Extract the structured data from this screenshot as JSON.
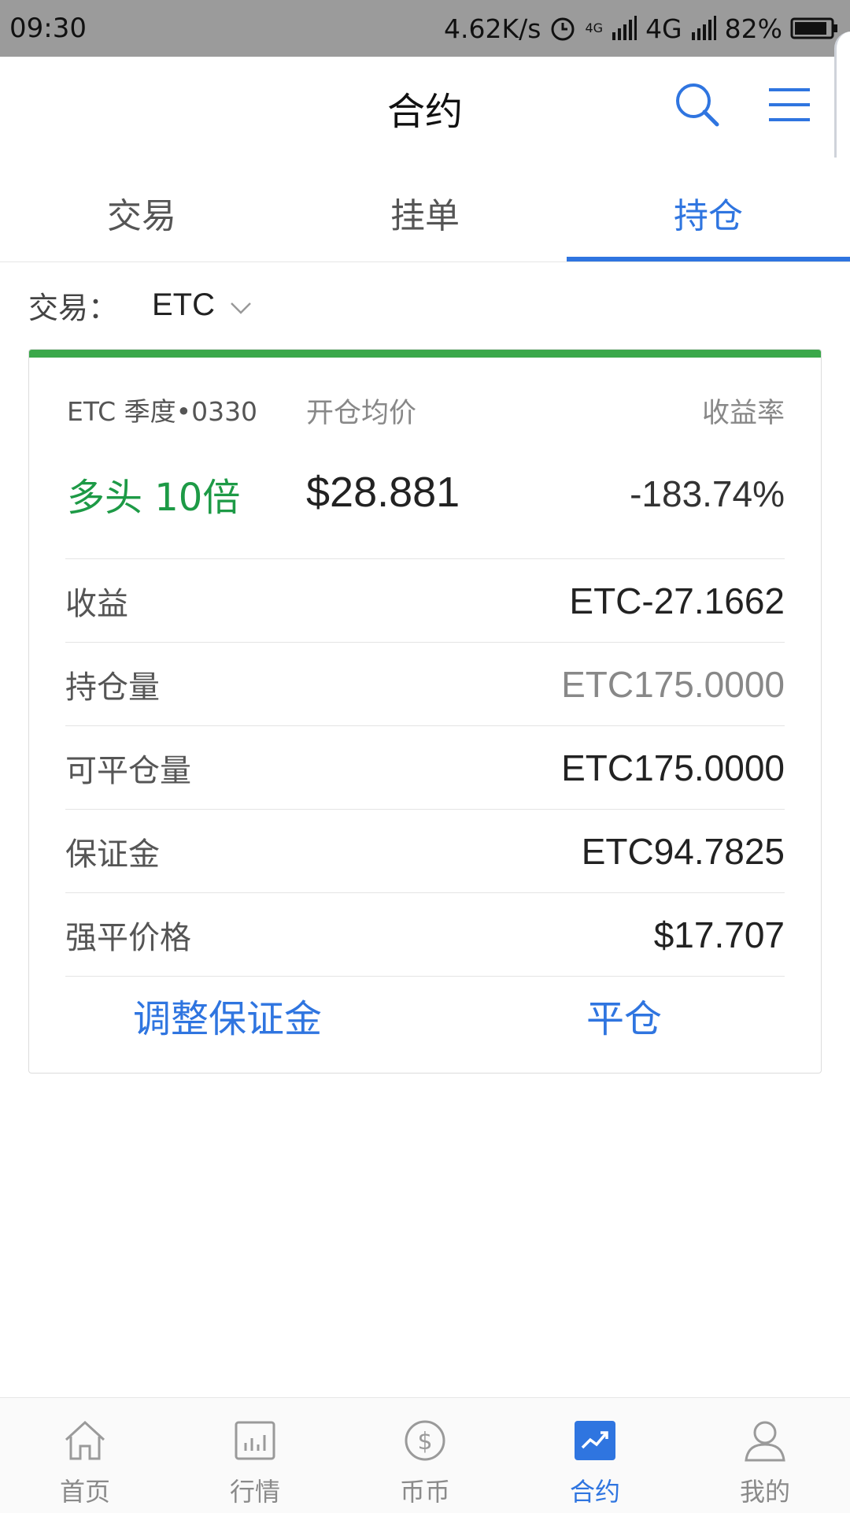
{
  "status_bar": {
    "time": "09:30",
    "net_speed": "4.62K/s",
    "network_type": "4G",
    "small_network": "4G",
    "battery": "82%",
    "icons": [
      "alarm-icon",
      "signal-icon",
      "battery-icon"
    ]
  },
  "header": {
    "title": "合约",
    "icons": [
      "search-icon",
      "menu-icon"
    ]
  },
  "tabs": [
    {
      "label": "交易",
      "active": false
    },
    {
      "label": "挂单",
      "active": false
    },
    {
      "label": "持仓",
      "active": true
    }
  ],
  "filter": {
    "label": "交易：",
    "value": "ETC"
  },
  "position": {
    "name": "ETC 季度•0330",
    "avg_price_label": "开仓均价",
    "rate_label": "收益率",
    "direction": "多头 10倍",
    "avg_price": "$28.881",
    "rate": "-183.74%",
    "rows": [
      {
        "label": "收益",
        "value": "ETC-27.1662"
      },
      {
        "label": "持仓量",
        "value": "ETC175.0000"
      },
      {
        "label": "可平仓量",
        "value": "ETC175.0000"
      },
      {
        "label": "保证金",
        "value": "ETC94.7825"
      },
      {
        "label": "强平价格",
        "value": "$17.707"
      }
    ],
    "actions": {
      "adjust_margin": "调整保证金",
      "close_position": "平仓"
    }
  },
  "bottom_nav": [
    {
      "label": "首页",
      "icon": "home-icon",
      "active": false
    },
    {
      "label": "行情",
      "icon": "chart-icon",
      "active": false
    },
    {
      "label": "币币",
      "icon": "dollar-icon",
      "active": false
    },
    {
      "label": "合约",
      "icon": "trend-icon",
      "active": true
    },
    {
      "label": "我的",
      "icon": "user-icon",
      "active": false
    }
  ],
  "colors": {
    "accent": "#2f75e0",
    "long_green": "#1d9a46",
    "card_bar": "#3aa84a",
    "status_bar_bg": "#9b9b9b"
  }
}
